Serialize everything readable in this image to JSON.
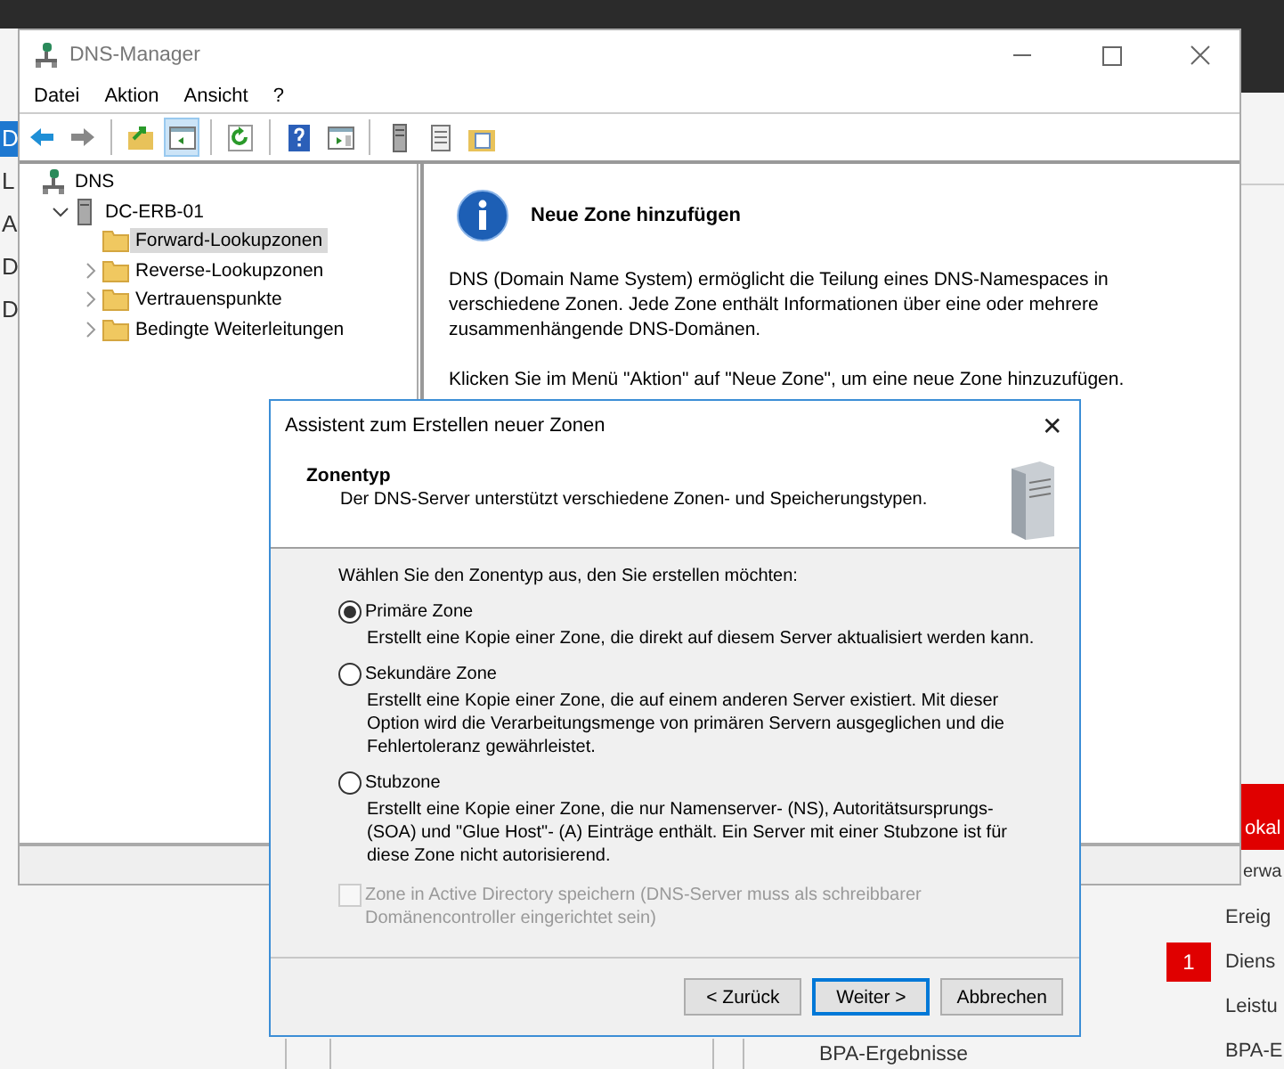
{
  "background_app": {
    "sidebar_items": [
      {
        "label": "D",
        "selected": true
      },
      {
        "label": "L",
        "selected": false
      },
      {
        "label": "A",
        "selected": false
      },
      {
        "label": "D",
        "selected": false
      },
      {
        "label": "D",
        "selected": false
      }
    ],
    "tile_header": "okal",
    "tile_rows": [
      {
        "label": "erwa"
      },
      {
        "label": "Ereig"
      },
      {
        "label": "Diens",
        "badge": "1"
      },
      {
        "label": "Leistu"
      },
      {
        "label": "BPA-E"
      }
    ],
    "bottom_label": "BPA-Ergebnisse"
  },
  "window": {
    "title": "DNS-Manager",
    "menu": [
      "Datei",
      "Aktion",
      "Ansicht",
      "?"
    ],
    "toolbar": [
      {
        "kind": "back",
        "pressed": false
      },
      {
        "kind": "forward",
        "pressed": false
      },
      {
        "kind": "separator"
      },
      {
        "kind": "up",
        "pressed": false
      },
      {
        "kind": "pane",
        "pressed": true
      },
      {
        "kind": "separator"
      },
      {
        "kind": "refresh",
        "pressed": false
      },
      {
        "kind": "separator"
      },
      {
        "kind": "help",
        "pressed": false
      },
      {
        "kind": "console",
        "pressed": false
      },
      {
        "kind": "separator"
      },
      {
        "kind": "server",
        "pressed": false
      },
      {
        "kind": "list",
        "pressed": false
      },
      {
        "kind": "folder",
        "pressed": false
      }
    ],
    "tree": [
      {
        "label": "DNS",
        "kind": "root",
        "expandable": false,
        "selected": false,
        "children": [
          {
            "label": "DC-ERB-01",
            "kind": "server",
            "expandable": true,
            "expanded": true,
            "selected": false,
            "children": [
              {
                "label": "Forward-Lookupzonen",
                "kind": "folder",
                "expandable": false,
                "selected": true
              },
              {
                "label": "Reverse-Lookupzonen",
                "kind": "folder",
                "expandable": true,
                "expanded": false,
                "selected": false
              },
              {
                "label": "Vertrauenspunkte",
                "kind": "folder",
                "expandable": true,
                "expanded": false,
                "selected": false
              },
              {
                "label": "Bedingte Weiterleitungen",
                "kind": "folder",
                "expandable": true,
                "expanded": false,
                "selected": false
              }
            ]
          }
        ]
      }
    ],
    "info": {
      "title": "Neue Zone hinzufügen",
      "paragraphs": [
        "DNS (Domain Name System) ermöglicht die Teilung eines DNS-Namespaces in verschiedene Zonen. Jede Zone enthält Informationen über eine oder mehrere zusammenhängende DNS-Domänen.",
        "Klicken Sie im Menü \"Aktion\" auf \"Neue Zone\", um eine neue Zone hinzuzufügen."
      ]
    }
  },
  "dialog": {
    "title": "Assistent zum Erstellen neuer Zonen",
    "close": "✕",
    "heading": "Zonentyp",
    "subheading": "Der DNS-Server unterstützt verschiedene Zonen- und Speicherungstypen.",
    "prompt": "Wählen Sie den Zonentyp aus, den Sie erstellen möchten:",
    "options": [
      {
        "label": "Primäre Zone",
        "description": "Erstellt eine Kopie einer Zone, die direkt auf diesem Server aktualisiert werden kann.",
        "selected": true
      },
      {
        "label": "Sekundäre Zone",
        "description": "Erstellt eine Kopie einer Zone, die auf einem anderen Server existiert. Mit dieser Option wird die Verarbeitungsmenge von primären Servern ausgeglichen und die Fehlertoleranz gewährleistet.",
        "selected": false
      },
      {
        "label": "Stubzone",
        "description": "Erstellt eine Kopie einer Zone, die nur Namenserver- (NS), Autoritätsursprungs- (SOA) und \"Glue Host\"- (A) Einträge enthält. Ein Server mit einer Stubzone ist für diese Zone nicht autorisierend.",
        "selected": false
      }
    ],
    "checkbox": {
      "label": "Zone in Active Directory speichern (DNS-Server muss als schreibbarer Domänencontroller eingerichtet sein)",
      "checked": false,
      "disabled": true
    },
    "buttons": [
      {
        "label": "< Zurück",
        "default": false
      },
      {
        "label": "Weiter >",
        "default": true
      },
      {
        "label": "Abbrechen",
        "default": false
      }
    ]
  }
}
